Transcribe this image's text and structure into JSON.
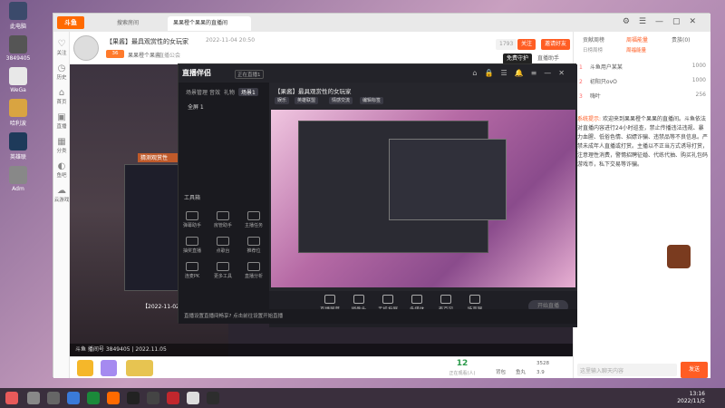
{
  "desktop": {
    "icons": [
      {
        "label": "此电脑"
      },
      {
        "label": "3849405"
      },
      {
        "label": "WeGa"
      },
      {
        "label": "哈利波"
      },
      {
        "label": "英雄联"
      },
      {
        "label": "Adm"
      }
    ]
  },
  "douyu": {
    "logo": "斗鱼",
    "tabs": [
      {
        "label": "搜索房间"
      },
      {
        "label": "果果橙个果果的直播间"
      }
    ],
    "left_nav": [
      {
        "label": "关注"
      },
      {
        "label": "历史"
      },
      {
        "label": "首页"
      },
      {
        "label": "直播"
      },
      {
        "label": "分类"
      },
      {
        "label": "鱼吧"
      },
      {
        "label": "云游戏"
      }
    ],
    "room": {
      "title": "【果酱】最具观赏性的女玩家",
      "time": "2022-11-04 20:50",
      "level": "36",
      "anchor": "果果橙个果酱",
      "location": "直播公会",
      "follow_count": "1793",
      "follow_label": "关注",
      "share_label": "邀请好友",
      "free_label": "免费守护",
      "mobile_label": "直播助手"
    },
    "video": {
      "banner": "猜测观赏性",
      "inner_date": "【2022-11-02",
      "bottom_left": "斗鱼 播间号",
      "room_id": "3849405",
      "date": "2022.11.05"
    },
    "gift_bar": {
      "count": "12",
      "count_label": "正在观看(人)",
      "gift_items": [
        "背包",
        "鱼丸",
        "3528",
        "3.9"
      ]
    },
    "right_panel": {
      "tabs": [
        {
          "label": "贡献周榜"
        },
        {
          "label": "周福能量"
        },
        {
          "label": "贵族(0)"
        }
      ],
      "sub_tabs": [
        "日榜周榜",
        "周福能量"
      ],
      "ranks": [
        {
          "rank": "1",
          "name": "斗鱼用户某某",
          "value": "1000"
        },
        {
          "rank": "2",
          "name": "初阳只ovO",
          "value": "1000"
        },
        {
          "rank": "3",
          "name": "嗨叶",
          "value": "256"
        }
      ],
      "system_msg_label": "系统提示:",
      "system_msg": "欢迎来到果果橙个果果的直播间。斗鱼依法对直播内容进行24小时巡查，禁止传播违法违规、暴力血腥、低俗色情、招嫖诈骗、违禁品等不良信息。严禁未成年人直播或打赏。主播以不正当方式诱导打赏，注意理性消费，警惕招聘征婚、代练代抽、购买礼包码游戏币，私下交易等诈骗。",
      "chat_placeholder": "这里输入聊天内容",
      "send_label": "发送"
    }
  },
  "companion": {
    "logo": "直播伴侣",
    "version": "正在直播1",
    "left_tabs": [
      {
        "label": "场景管理"
      },
      {
        "label": "音效"
      },
      {
        "label": "礼物"
      },
      {
        "label": "场景1"
      }
    ],
    "scene": "全屏 1",
    "tools_title": "工具箱",
    "tools": [
      {
        "label": "弹幕助手"
      },
      {
        "label": "房管助手"
      },
      {
        "label": "主播任务"
      },
      {
        "label": "抽奖直播"
      },
      {
        "label": "点歌台"
      },
      {
        "label": "推荐位"
      },
      {
        "label": "连麦PK"
      },
      {
        "label": "更多工具"
      },
      {
        "label": "直播分析"
      }
    ],
    "title": "【果酱】最具观赏性的女玩家",
    "tags": [
      "娱乐",
      "英雄联盟",
      "情感交流",
      "编辑标签"
    ],
    "toolbar": [
      {
        "label": "直播屏幕"
      },
      {
        "label": "摄像头"
      },
      {
        "label": "手机投屏"
      },
      {
        "label": "多媒体"
      },
      {
        "label": "麦克风"
      },
      {
        "label": "扬声器"
      }
    ],
    "go_live": "开始直播",
    "status_bar": "直播设置直播间畅享? 点击前往设置开始直播"
  },
  "taskbar": {
    "time": "13:16",
    "date": "2022/11/5"
  },
  "colors": {
    "douyu_orange": "#ff5d23",
    "companion_bg": "#1d1d22",
    "viewer_green": "#2b9a4b"
  }
}
